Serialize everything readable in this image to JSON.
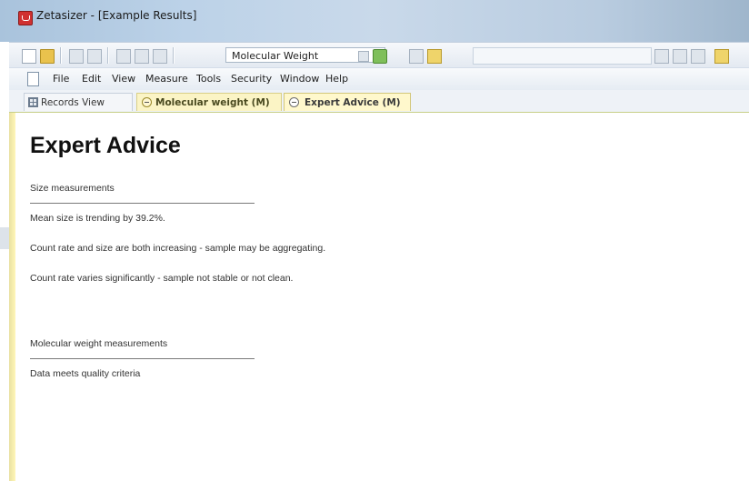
{
  "window": {
    "title": "Zetasizer - [Example Results]"
  },
  "toolbar": {
    "analysis_combo_value": "Molecular Weight"
  },
  "menu": {
    "items": [
      "File",
      "Edit",
      "View",
      "Measure",
      "Tools",
      "Security",
      "Window",
      "Help"
    ]
  },
  "tabs": [
    {
      "label": "Records View"
    },
    {
      "label": "Molecular weight (M)"
    },
    {
      "label": "Expert Advice (M)"
    }
  ],
  "content": {
    "heading": "Expert Advice",
    "size_section": {
      "title": "Size measurements",
      "messages": [
        "Mean size is trending by 39.2%.",
        "Count rate and size are both increasing - sample may be aggregating.",
        "Count rate varies significantly - sample not stable or not clean."
      ]
    },
    "mw_section": {
      "title": "Molecular weight measurements",
      "messages": [
        "Data meets quality criteria"
      ]
    }
  },
  "colors": {
    "accent_tab": "#fff8cc",
    "title_bar": "#bcd2e8"
  }
}
